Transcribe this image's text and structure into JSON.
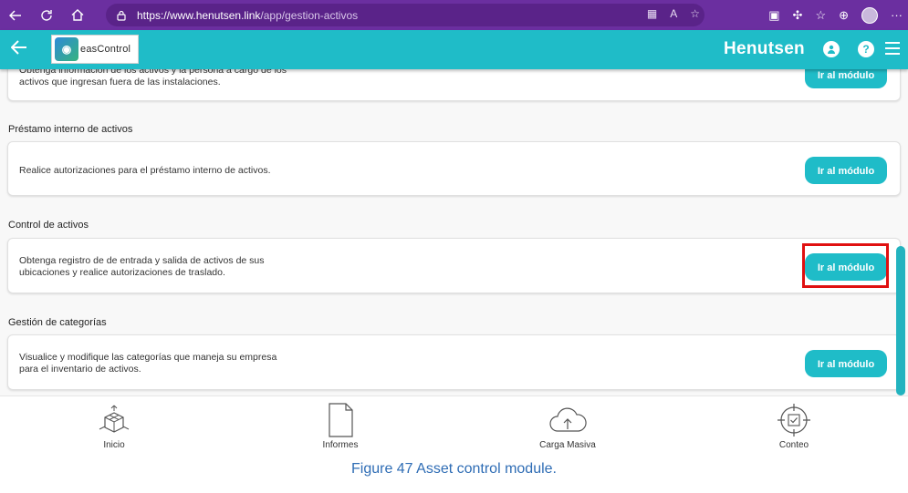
{
  "browser": {
    "url_host": "https://www.henutsen.link",
    "url_path": "/app/gestion-activos"
  },
  "header": {
    "logo_text": "easControl",
    "brand": "Henutsen",
    "help_glyph": "?"
  },
  "sections": [
    {
      "title": "",
      "text": "Obtenga información de los activos y la persona a cargo de los activos que ingresan fuera de las  instalaciones.",
      "button": "Ir al módulo"
    },
    {
      "title": "Préstamo interno de activos",
      "text": "Realice autorizaciones para el préstamo interno  de activos.",
      "button": "Ir al módulo"
    },
    {
      "title": "Control de activos",
      "text": "Obtenga registro de de entrada y salida de activos de sus ubicaciones y realice autorizaciones de traslado.",
      "button": "Ir al módulo"
    },
    {
      "title": "Gestión de categorías",
      "text": "Visualice y modifique las categorías que maneja su empresa para el inventario de activos.",
      "button": "Ir al módulo"
    }
  ],
  "bottom_nav": [
    {
      "label": "Inicio",
      "icon": "home-cube-icon"
    },
    {
      "label": "Informes",
      "icon": "document-icon"
    },
    {
      "label": "Carga Masiva",
      "icon": "cloud-upload-icon"
    },
    {
      "label": "Conteo",
      "icon": "target-check-icon"
    }
  ],
  "caption": "Figure 47 Asset control module.",
  "colors": {
    "browser": "#6b2fa0",
    "teal": "#1fbcc8",
    "highlight": "#e01010",
    "caption": "#2f6db5"
  }
}
